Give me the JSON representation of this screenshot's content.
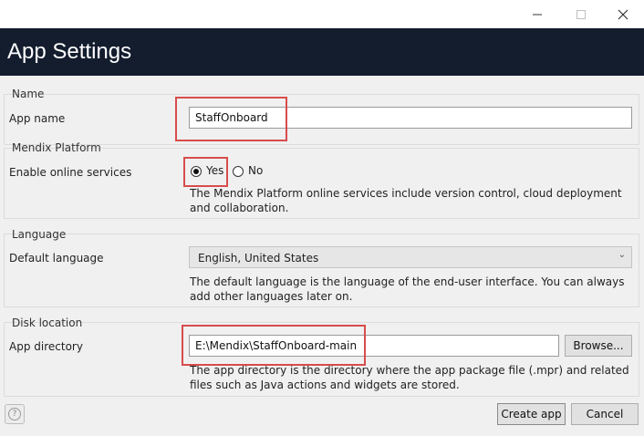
{
  "window": {
    "minimize_icon": "minimize-icon",
    "maximize_icon": "maximize-icon",
    "close_icon": "close-icon"
  },
  "header": {
    "title": "App Settings",
    "background": "#131d2e"
  },
  "name_group": {
    "title": "Name",
    "app_name_label": "App name",
    "app_name_value": "StaffOnboard"
  },
  "platform_group": {
    "title": "Mendix Platform",
    "online_services_label": "Enable online services",
    "yes_label": "Yes",
    "no_label": "No",
    "selected": "Yes",
    "hint": "The Mendix Platform online services include version control, cloud deployment and collaboration."
  },
  "language_group": {
    "title": "Language",
    "default_language_label": "Default language",
    "default_language_value": "English, United States",
    "hint": "The default language is the language of the end-user interface. You can always add other languages later on."
  },
  "disk_group": {
    "title": "Disk location",
    "app_directory_label": "App directory",
    "app_directory_value": "E:\\Mendix\\StaffOnboard-main",
    "browse_label": "Browse...",
    "hint": "The app directory is the directory where the app package file (.mpr) and related files such as Java actions and widgets are stored."
  },
  "footer": {
    "help_icon": "help-icon",
    "create_label": "Create app",
    "cancel_label": "Cancel"
  },
  "colors": {
    "highlight": "#d84c4c"
  }
}
